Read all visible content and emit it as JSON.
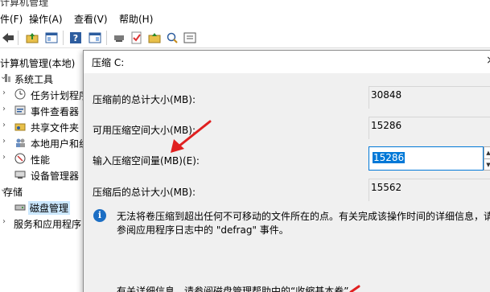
{
  "window": {
    "title_fragment": "计算机管理"
  },
  "menubar": {
    "items": [
      "件(F)",
      "操作(A)",
      "查看(V)",
      "帮助(H)"
    ]
  },
  "toolbar": {
    "icons": [
      "back-arrow-icon",
      "up-folder-icon",
      "console-tree-icon",
      "help-icon",
      "action-pane-icon",
      "connect-icon",
      "check-icon",
      "folder-up-icon",
      "search-icon",
      "properties-icon"
    ]
  },
  "tree": {
    "items": [
      {
        "label": "计算机管理(本地)",
        "icon": "computer-management-icon"
      },
      {
        "label": "系统工具",
        "icon": "system-tools-icon"
      },
      {
        "label": "任务计划程序",
        "icon": "task-scheduler-icon"
      },
      {
        "label": "事件查看器",
        "icon": "event-viewer-icon"
      },
      {
        "label": "共享文件夹",
        "icon": "shared-folders-icon"
      },
      {
        "label": "本地用户和组",
        "icon": "local-users-icon"
      },
      {
        "label": "性能",
        "icon": "performance-icon"
      },
      {
        "label": "设备管理器",
        "icon": "device-manager-icon"
      },
      {
        "label": "存储",
        "icon": "storage-icon"
      },
      {
        "label": "磁盘管理",
        "icon": "disk-management-icon"
      },
      {
        "label": "服务和应用程序",
        "icon": "services-apps-icon"
      }
    ]
  },
  "dialog": {
    "title": "压缩 C:",
    "close_glyph": "×",
    "total_before_label": "压缩前的总计大小(MB):",
    "total_before_value": "30848",
    "available_label": "可用压缩空间大小(MB):",
    "available_value": "15286",
    "input_label": "输入压缩空间量(MB)(E):",
    "input_value": "15286",
    "total_after_label": "压缩后的总计大小(MB):",
    "total_after_value": "15562",
    "info_line1": "无法将卷压缩到超出任何不可移动的文件所在的点。有关完成该操作时间的详细信息，请",
    "info_line2": "参阅应用程序日志中的 \"defrag\" 事件。",
    "help_line": "有关详细信息，请参阅磁盘管理帮助中的“收缩基本卷”"
  },
  "colors": {
    "accent": "#0078d7",
    "selection": "#cce8ff",
    "dialog_bg": "#f0f0f0",
    "annotation_arrow": "#e02020"
  }
}
